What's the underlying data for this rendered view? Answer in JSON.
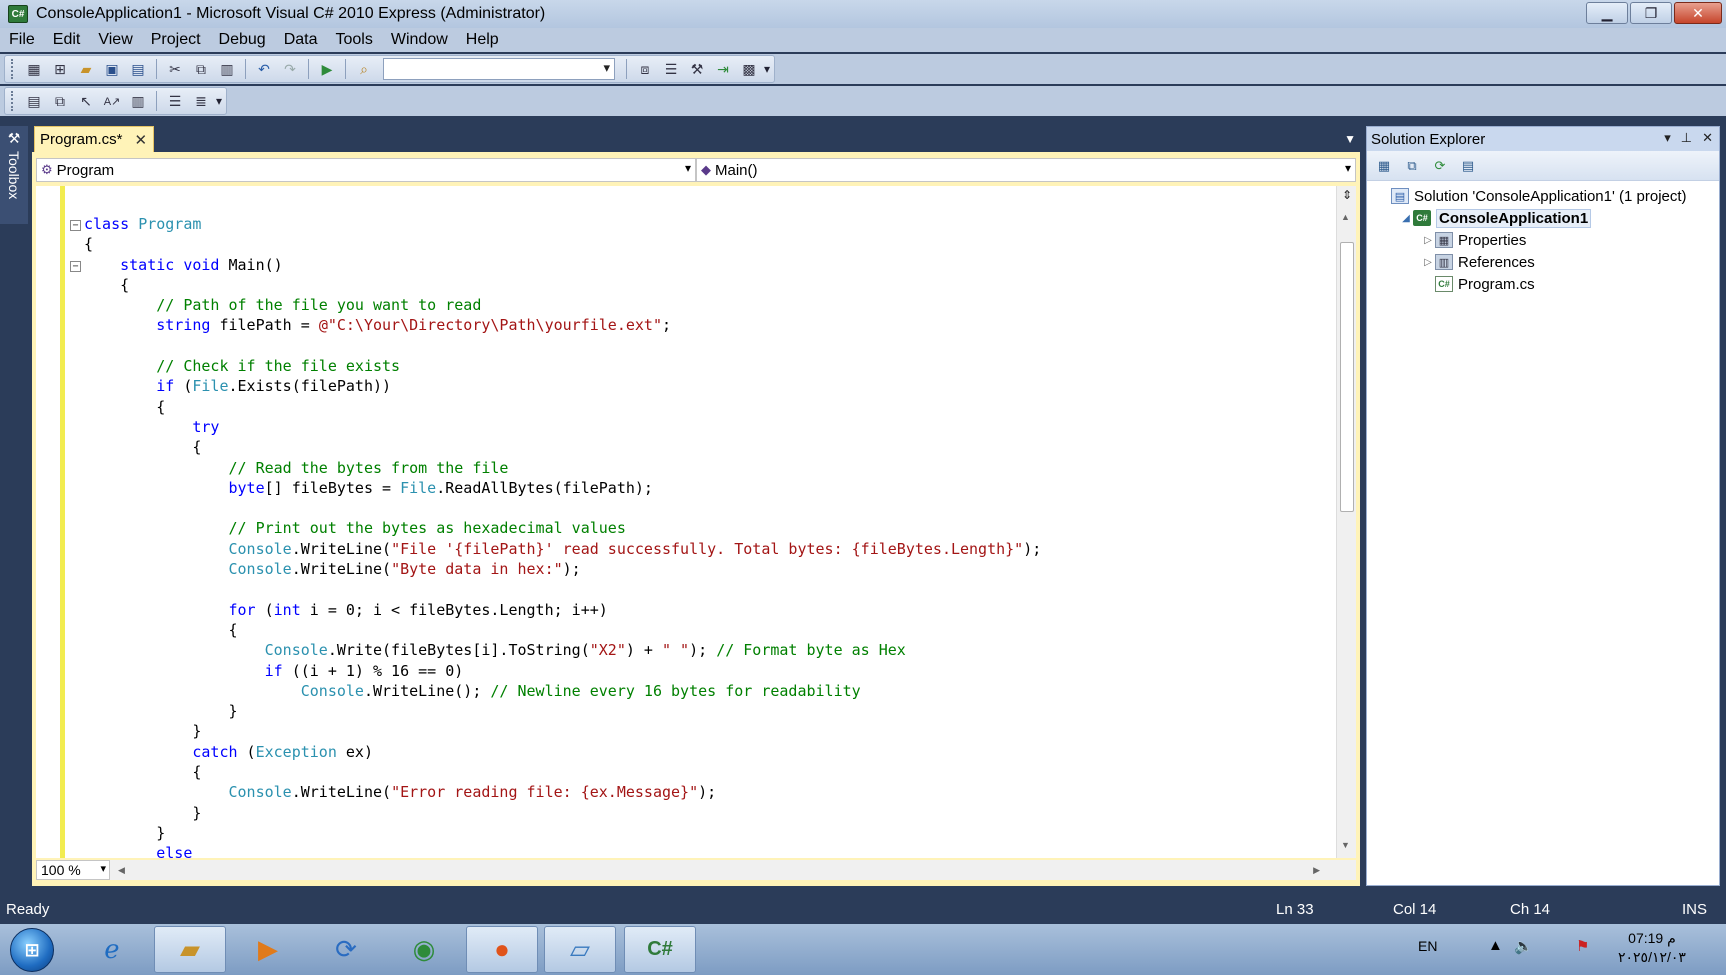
{
  "window": {
    "title": "ConsoleApplication1 - Microsoft Visual C# 2010 Express (Administrator)",
    "app_icon": "C#",
    "controls": [
      "minimize",
      "maximize",
      "close"
    ]
  },
  "menu": [
    "File",
    "Edit",
    "View",
    "Project",
    "Debug",
    "Data",
    "Tools",
    "Window",
    "Help"
  ],
  "toolbar1": {
    "icons": [
      "new-project-icon",
      "add-item-icon",
      "open-icon",
      "save-icon",
      "save-all-icon",
      "cut-icon",
      "copy-icon",
      "paste-icon",
      "undo-icon",
      "redo-icon",
      "start-debugging-icon",
      "find-in-files-icon"
    ],
    "find_combo_value": "",
    "right_icons": [
      "solution-explorer-icon",
      "properties-icon",
      "toolbox-icon",
      "start-page-icon",
      "extension-manager-icon"
    ]
  },
  "toolbar2": {
    "icons": [
      "text-editor-1-icon",
      "text-editor-2-icon",
      "text-editor-3-icon",
      "text-editor-4-icon",
      "text-editor-5-icon",
      "comment-icon",
      "uncomment-icon"
    ]
  },
  "toolbox": {
    "label": "Toolbox"
  },
  "editor": {
    "tab_label": "Program.cs*",
    "nav_left": "Program",
    "nav_right": "Main()",
    "zoom": "100 %",
    "lines": [
      "class Program",
      "{",
      "    static void Main()",
      "    {",
      "        // Path of the file you want to read",
      "        string filePath = @\"C:\\Your\\Directory\\Path\\yourfile.ext\";",
      "",
      "        // Check if the file exists",
      "        if (File.Exists(filePath))",
      "        {",
      "            try",
      "            {",
      "                // Read the bytes from the file",
      "                byte[] fileBytes = File.ReadAllBytes(filePath);",
      "",
      "                // Print out the bytes as hexadecimal values",
      "                Console.WriteLine(\"File '{filePath}' read successfully. Total bytes: {fileBytes.Length}\");",
      "                Console.WriteLine(\"Byte data in hex:\");",
      "",
      "                for (int i = 0; i < fileBytes.Length; i++)",
      "                {",
      "                    Console.Write(fileBytes[i].ToString(\"X2\") + \" \"); // Format byte as Hex",
      "                    if ((i + 1) % 16 == 0)",
      "                        Console.WriteLine(); // Newline every 16 bytes for readability",
      "                }",
      "            }",
      "            catch (Exception ex)",
      "            {",
      "                Console.WriteLine(\"Error reading file: {ex.Message}\");",
      "            }",
      "        }",
      "        else"
    ]
  },
  "solution_explorer": {
    "title": "Solution Explorer",
    "tree": [
      {
        "label": "Solution 'ConsoleApplication1' (1 project)",
        "icon": "solution-icon",
        "level": 0
      },
      {
        "label": "ConsoleApplication1",
        "icon": "csharp-project-icon",
        "level": 1
      },
      {
        "label": "Properties",
        "icon": "properties-folder-icon",
        "level": 2
      },
      {
        "label": "References",
        "icon": "references-folder-icon",
        "level": 2
      },
      {
        "label": "Program.cs",
        "icon": "csharp-file-icon",
        "level": 2
      }
    ]
  },
  "status": {
    "ready": "Ready",
    "ln": "Ln 33",
    "col": "Col 14",
    "ch": "Ch 14",
    "ins": "INS"
  },
  "taskbar": {
    "apps": [
      "internet-explorer-icon",
      "file-explorer-icon",
      "media-player-icon",
      "app-icon",
      "chrome-icon",
      "firefox-icon",
      "notepad-icon",
      "visual-csharp-icon"
    ],
    "language": "EN",
    "time": "07:19 م",
    "date": "٢٠٢٥/١٢/٠٣"
  },
  "colors": {
    "keyword": "#0000ff",
    "type": "#2b91af",
    "comment": "#008000",
    "string": "#a31515",
    "chrome": "#2b3c59"
  }
}
